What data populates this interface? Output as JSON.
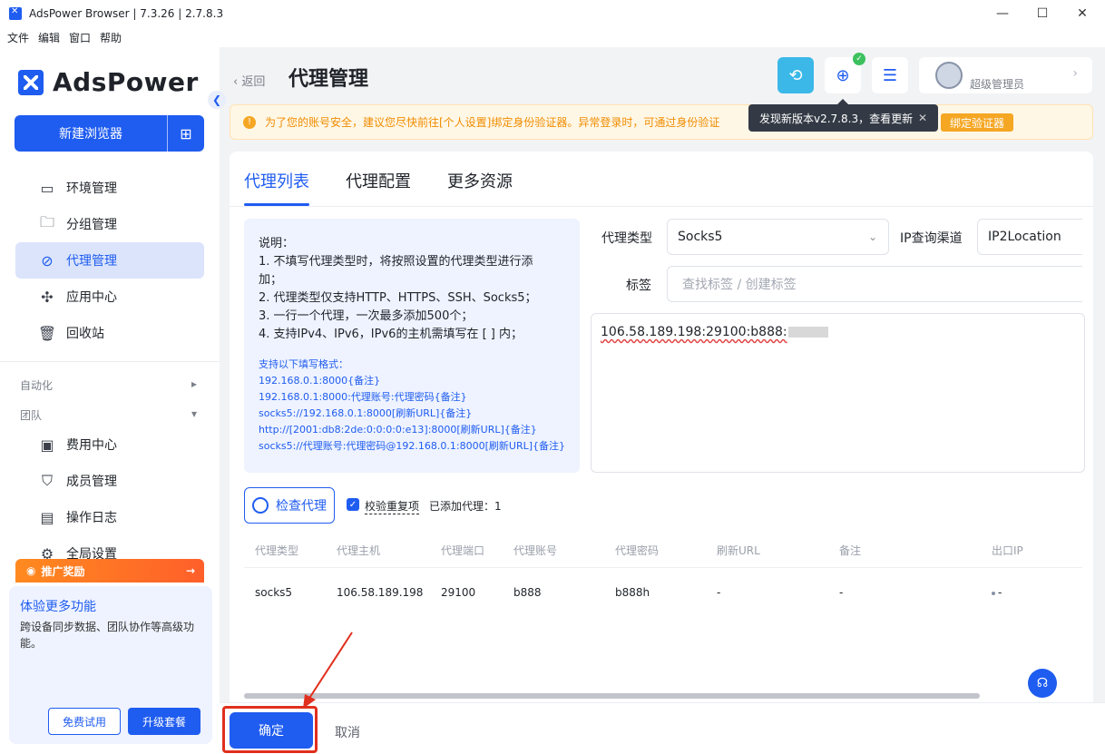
{
  "window": {
    "title": "AdsPower Browser | 7.3.26 | 2.7.8.3",
    "minimize": "—",
    "maximize": "☐",
    "close": "✕"
  },
  "menu": [
    "文件",
    "编辑",
    "窗口",
    "帮助"
  ],
  "sidebar": {
    "logo": "AdsPower",
    "new_browser": "新建浏览器",
    "items": [
      {
        "label": "环境管理",
        "icon": "browser-window-icon"
      },
      {
        "label": "分组管理",
        "icon": "folder-icon"
      },
      {
        "label": "代理管理",
        "icon": "proxy-icon"
      },
      {
        "label": "应用中心",
        "icon": "puzzle-icon"
      },
      {
        "label": "回收站",
        "icon": "trash-icon"
      }
    ],
    "section_automation": "自动化",
    "section_team": "团队",
    "team_items": [
      {
        "label": "费用中心",
        "icon": "wallet-icon"
      },
      {
        "label": "成员管理",
        "icon": "shield-user-icon"
      },
      {
        "label": "操作日志",
        "icon": "log-icon"
      },
      {
        "label": "全局设置",
        "icon": "settings-icon"
      }
    ],
    "promo_label": "推广奖励",
    "promo_title": "体验更多功能",
    "promo_desc": "跨设备同步数据、团队协作等高级功能。",
    "free_trial": "免费试用",
    "upgrade": "升级套餐"
  },
  "header": {
    "back": "返回",
    "title": "代理管理",
    "user_role": "超级管理员"
  },
  "warning": {
    "text": "为了您的账号安全，建议您尽快前往[个人设置]绑定身份验证器。异常登录时，可通过身份验证",
    "button": "绑定验证器"
  },
  "tooltip": {
    "text": "发现新版本v2.7.8.3，查看更新"
  },
  "tabs": [
    "代理列表",
    "代理配置",
    "更多资源"
  ],
  "instructions": {
    "title": "说明：",
    "lines": [
      "1. 不填写代理类型时，将按照设置的代理类型进行添",
      "加；",
      "2. 代理类型仅支持HTTP、HTTPS、SSH、Socks5；",
      "3. 一行一个代理，一次最多添加500个；",
      "4. 支持IPv4、IPv6，IPv6的主机需填写在 [ ] 内；"
    ],
    "format_head": "支持以下填写格式：",
    "formats": [
      "192.168.0.1:8000{备注}",
      "192.168.0.1:8000:代理账号:代理密码{备注}",
      "socks5://192.168.0.1:8000[刷新URL]{备注}",
      "http://[2001:db8:2de:0:0:0:0:e13]:8000[刷新URL]{备注}",
      "socks5://代理账号:代理密码@192.168.0.1:8000[刷新URL]{备注}"
    ]
  },
  "form": {
    "proxy_type_label": "代理类型",
    "proxy_type_value": "Socks5",
    "ip_channel_label": "IP查询渠道",
    "ip_channel_value": "IP2Location",
    "tag_label": "标签",
    "tag_placeholder": "查找标签 / 创建标签",
    "proxy_input": "106.58.189.198:29100:b888:"
  },
  "actions": {
    "check_proxy": "检查代理",
    "dedupe_label": "校验重复项",
    "added": "已添加代理：1"
  },
  "table": {
    "headers": [
      "代理类型",
      "代理主机",
      "代理端口",
      "代理账号",
      "代理密码",
      "刷新URL",
      "备注",
      "出口IP"
    ],
    "rows": [
      [
        "socks5",
        "106.58.189.198",
        "29100",
        "b888",
        "b888h",
        "-",
        "-",
        "-"
      ]
    ]
  },
  "footer": {
    "confirm": "确定",
    "cancel": "取消"
  },
  "colors": {
    "primary": "#1f5cf0",
    "warning": "#f5a623",
    "highlight": "#e0301e"
  }
}
